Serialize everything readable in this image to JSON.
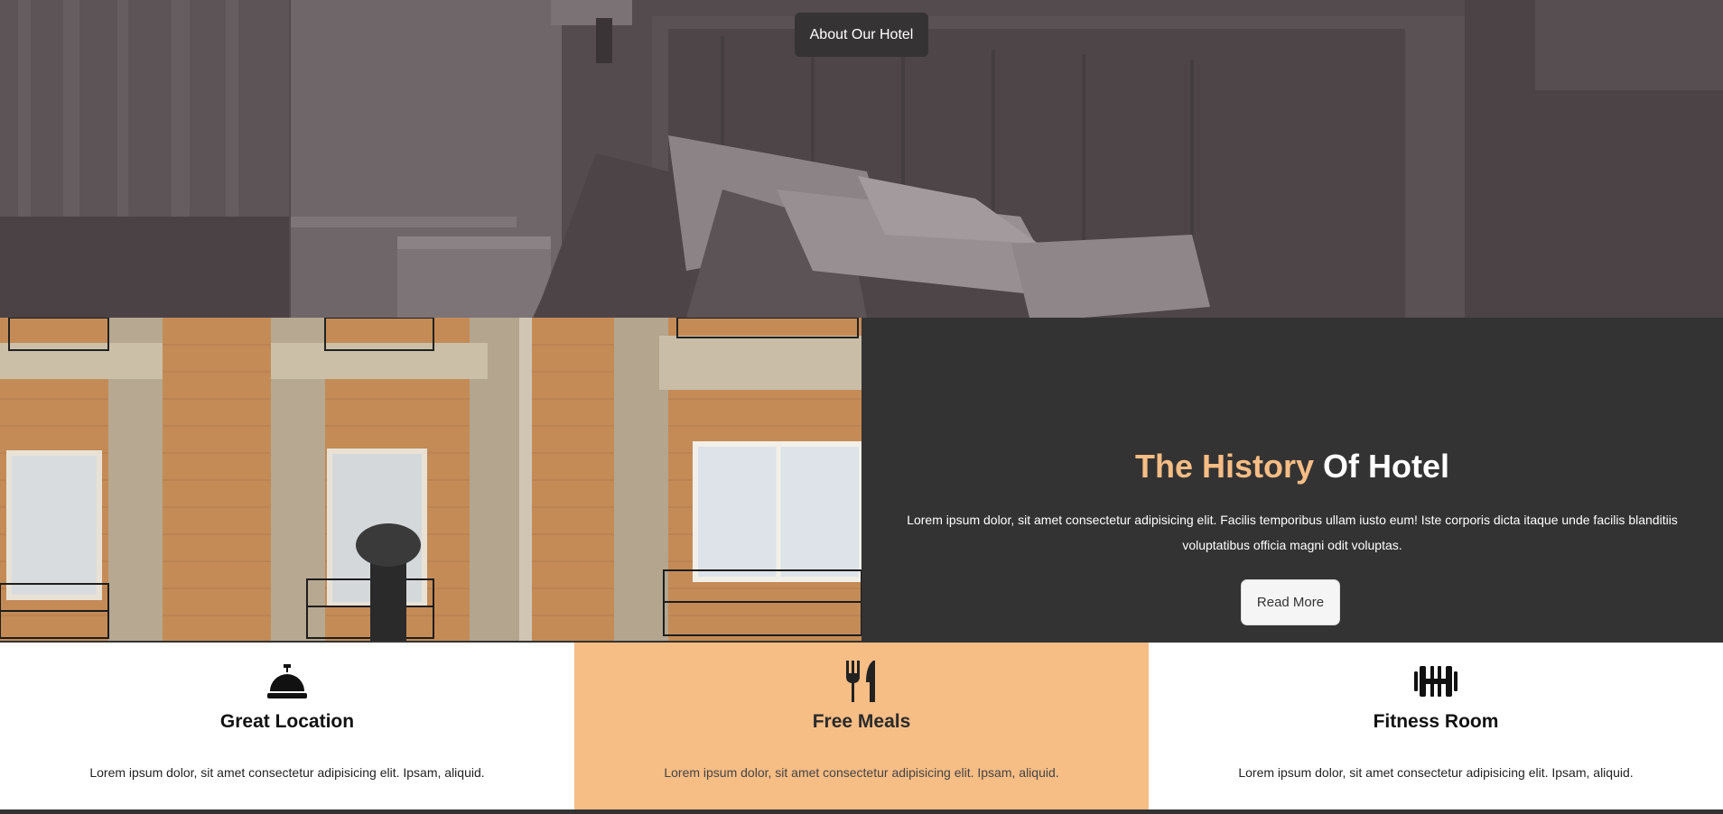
{
  "hero": {
    "badge_label": "About Our Hotel"
  },
  "history": {
    "title_accent": "The History",
    "title_rest": "Of Hotel",
    "body": "Lorem ipsum dolor, sit amet consectetur adipisicing elit. Facilis temporibus ullam iusto eum! Iste corporis dicta itaque unde facilis blanditiis voluptatibus officia magni odit voluptas.",
    "button_label": "Read More"
  },
  "features": [
    {
      "title": "Great Location",
      "text": "Lorem ipsum dolor, sit amet consectetur adipisicing elit. Ipsam, aliquid.",
      "icon": "concierge-bell-icon"
    },
    {
      "title": "Free Meals",
      "text": "Lorem ipsum dolor, sit amet consectetur adipisicing elit. Ipsam, aliquid.",
      "icon": "utensils-icon"
    },
    {
      "title": "Fitness Room",
      "text": "Lorem ipsum dolor, sit amet consectetur adipisicing elit. Ipsam, aliquid.",
      "icon": "dumbbell-icon"
    }
  ],
  "colors": {
    "accent": "#f6bd85",
    "dark": "#333333",
    "hero_overlay": "#4f4749"
  }
}
